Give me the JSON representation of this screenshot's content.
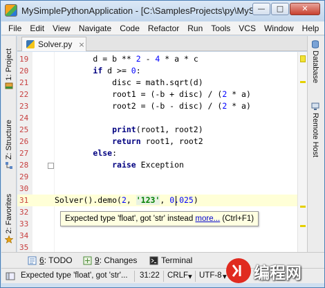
{
  "window": {
    "title": "MySimplePythonApplication - [C:\\SamplesProjects\\py\\MySi...",
    "min_label": "—",
    "max_label": "□",
    "close_label": "✕"
  },
  "menu": [
    "File",
    "Edit",
    "View",
    "Navigate",
    "Code",
    "Refactor",
    "Run",
    "Tools",
    "VCS",
    "Window",
    "Help"
  ],
  "left_tools": {
    "project": "1: Project",
    "structure": "Z: Structure",
    "favorites": "2: Favorites"
  },
  "right_tools": {
    "database": "Database",
    "remote_host": "Remote Host"
  },
  "editor_tab": {
    "name": "Solver.py",
    "close": "×"
  },
  "code_lines": [
    {
      "n": "19",
      "text": "        d = b ** 2 - 4 * a * c"
    },
    {
      "n": "20",
      "text": "        if d >= 0:"
    },
    {
      "n": "21",
      "text": "            disc = math.sqrt(d)"
    },
    {
      "n": "22",
      "text": "            root1 = (-b + disc) / (2 * a)"
    },
    {
      "n": "23",
      "text": "            root2 = (-b - disc) / (2 * a)"
    },
    {
      "n": "24",
      "text": ""
    },
    {
      "n": "25",
      "text": "            print(root1, root2)"
    },
    {
      "n": "26",
      "text": "            return root1, root2"
    },
    {
      "n": "27",
      "text": "        else:"
    },
    {
      "n": "28",
      "text": "            raise Exception"
    },
    {
      "n": "29",
      "text": ""
    },
    {
      "n": "30",
      "text": ""
    },
    {
      "n": "31",
      "text": "Solver().demo(2, '123', 0.025)"
    },
    {
      "n": "32",
      "text": ""
    },
    {
      "n": "33",
      "text": ""
    },
    {
      "n": "34",
      "text": ""
    },
    {
      "n": "35",
      "text": ""
    }
  ],
  "tooltip": {
    "message": "Expected type 'float', got 'str' instead",
    "link": "more...",
    "shortcut": "(Ctrl+F1)"
  },
  "bottom_tabs": {
    "todo_num": "6",
    "todo_label": ": TODO",
    "changes_num": "9",
    "changes_label": ": Changes",
    "terminal": "Terminal"
  },
  "status": {
    "message": "Expected type 'float', got 'str'...",
    "position": "31:22",
    "line_sep": "CRLF",
    "encoding": "UTF-8"
  },
  "watermark": {
    "text": "编程网"
  },
  "colors": {
    "line_number": "#c73e3e",
    "keyword": "#000080",
    "number": "#0000ff",
    "string": "#008000",
    "current_line": "#ffffd7",
    "warning_mark": "#e5d000"
  }
}
